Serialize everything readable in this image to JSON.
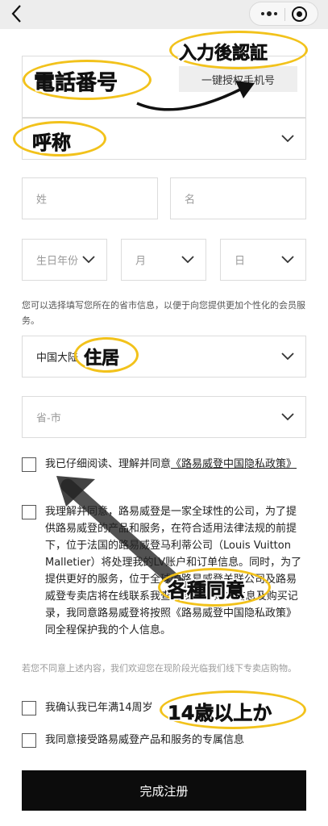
{
  "form": {
    "phone_auth_button": "一键授权手机号",
    "surname_placeholder": "姓",
    "given_name_placeholder": "名",
    "birth_year_placeholder": "生日年份",
    "birth_month_placeholder": "月",
    "birth_day_placeholder": "日",
    "region_hint": "您可以选择填写您所在的省市信息，以便于向您提供更加个性化的会员服务。",
    "country_value": "中国大陆",
    "province_city_placeholder": "省-市",
    "consent_privacy": "我已仔细阅读、理解并同意",
    "consent_privacy_link": "《路易威登中国隐私政策》",
    "consent_transfer": "我理解并同意，路易威登是一家全球性的公司，为了提供路易威登的产品和服务，在符合适用法律法规的前提下，位于法国的路易威登马利蒂公司（Louis Vuitton Malletier）将处理我的LV账户和订单信息。同时，为了提供更好的服务，位于全球的路易威登关联公司及路易威登专卖店将在线联系我查询我的LV账户信息及购买记录，我同意路易威登将按照《路易威登中国隐私政策》同全程保护我的个人信息。",
    "decline_hint": "若您不同意上述内容，我们欢迎您在现阶段光临我们线下专卖店购物。",
    "consent_age": "我确认我已年满14周岁",
    "consent_marketing": "我同意接受路易威登产品和服务的专属信息",
    "submit_label": "完成注册"
  },
  "annotations": {
    "phone": "電話番号",
    "auth": "入力後認証",
    "salutation": "呼称",
    "residence": "住居",
    "consents": "各種同意",
    "age": "14歳以上か"
  },
  "colors": {
    "highlight": "#f2c21b",
    "submit_bg": "#0c0c0c"
  },
  "icons": [
    "back-arrow-icon",
    "more-dots-icon",
    "close-circle-icon",
    "chevron-down-icon"
  ]
}
